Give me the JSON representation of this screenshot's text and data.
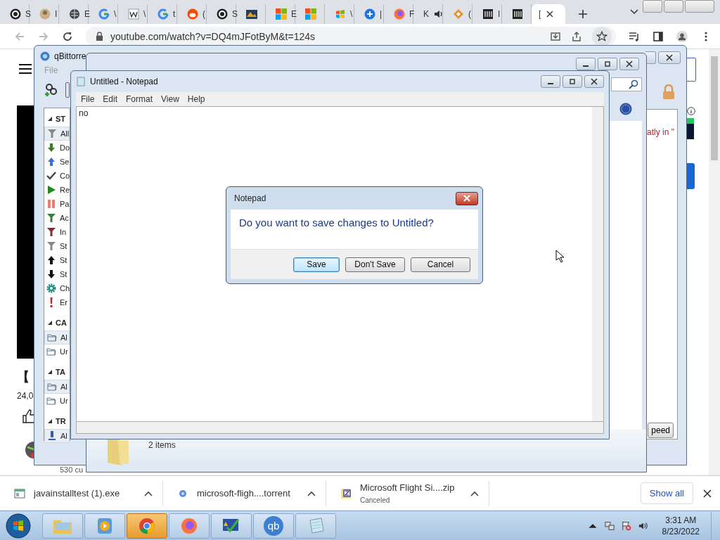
{
  "browser": {
    "tabs": [
      {
        "kind": "dial",
        "label": "S",
        "selected": false
      },
      {
        "kind": "avatar",
        "label": "I",
        "selected": false
      },
      {
        "kind": "globe",
        "label": "E",
        "selected": false
      },
      {
        "kind": "google",
        "label": "\\",
        "selected": false
      },
      {
        "kind": "wiki",
        "label": "\\",
        "selected": false
      },
      {
        "kind": "google",
        "label": "t",
        "selected": false
      },
      {
        "kind": "reddit",
        "label": "(",
        "selected": false
      },
      {
        "kind": "dial",
        "label": "S",
        "selected": false
      },
      {
        "kind": "hfs",
        "selected": false
      },
      {
        "kind": "ms",
        "label": "E",
        "selected": false
      },
      {
        "kind": "ms",
        "selected": false
      },
      {
        "kind": "win",
        "label": "\\",
        "selected": false
      },
      {
        "kind": "edge",
        "label": "|",
        "selected": false
      },
      {
        "kind": "firefox",
        "label": "F",
        "selected": false
      },
      {
        "kind": "speaker",
        "label": "K",
        "selected": false
      },
      {
        "kind": "diamond",
        "label": "(",
        "selected": false
      },
      {
        "kind": "museum",
        "label": "I",
        "selected": false
      },
      {
        "kind": "museum",
        "selected": false
      },
      {
        "kind": "none",
        "label": "[",
        "selected": true
      }
    ],
    "url": "youtube.com/watch?v=DQ4mJFotByM&t=124s"
  },
  "page": {
    "title": "【",
    "views": "24,0",
    "comment": "530 cu"
  },
  "qbittorrent": {
    "title": "qBittorre",
    "menu": [
      "File"
    ],
    "sections": [
      {
        "header": "ST",
        "items": [
          {
            "kind": "filter-grey",
            "label": "All",
            "selected": true
          },
          {
            "kind": "down-green",
            "label": "Do",
            "selected": false
          },
          {
            "kind": "up-blue",
            "label": "Se",
            "selected": false
          },
          {
            "kind": "check",
            "label": "Co",
            "selected": false
          },
          {
            "kind": "play",
            "label": "Re",
            "selected": false
          },
          {
            "kind": "pause",
            "label": "Pa",
            "selected": false
          },
          {
            "kind": "filter-green",
            "label": "Ac",
            "selected": false
          },
          {
            "kind": "filter-red",
            "label": "In",
            "selected": false
          },
          {
            "kind": "filter-grey",
            "label": "St",
            "selected": false
          },
          {
            "kind": "up-black",
            "label": "St",
            "selected": false
          },
          {
            "kind": "down-black",
            "label": "St",
            "selected": false
          },
          {
            "kind": "gear",
            "label": "Ch",
            "selected": false
          },
          {
            "kind": "error",
            "label": "Er",
            "selected": false
          }
        ]
      },
      {
        "header": "CA",
        "items": [
          {
            "kind": "folder",
            "label": "Al",
            "selected": true
          },
          {
            "kind": "folder",
            "label": "Ur",
            "selected": false
          }
        ]
      },
      {
        "header": "TA",
        "items": [
          {
            "kind": "folder",
            "label": "Al",
            "selected": true
          },
          {
            "kind": "folder",
            "label": "Ur",
            "selected": false
          }
        ]
      },
      {
        "header": "TR",
        "items": [
          {
            "kind": "tracker",
            "label": "Al",
            "selected": true
          }
        ]
      }
    ],
    "column_text": "atly in \"",
    "button": "peed"
  },
  "explorer": {
    "status": "2 items"
  },
  "notepad": {
    "title": "Untitled - Notepad",
    "menu": [
      "File",
      "Edit",
      "Format",
      "View",
      "Help"
    ],
    "text": "no"
  },
  "dialog": {
    "title": "Notepad",
    "message": "Do you want to save changes to Untitled?",
    "buttons": [
      {
        "label": "Save",
        "default": true
      },
      {
        "label": "Don't Save",
        "default": false
      },
      {
        "label": "Cancel",
        "default": false
      }
    ]
  },
  "downloads": {
    "items": [
      {
        "kind": "exe",
        "name": "javainstalltest (1).exe"
      },
      {
        "kind": "torrent",
        "name": "microsoft-fligh....torrent"
      },
      {
        "kind": "zip",
        "name": "Microsoft Flight Si....zip",
        "status": "Canceled"
      }
    ],
    "show_all": "Show all"
  },
  "taskbar": {
    "apps": [
      {
        "kind": "explorer",
        "active": false
      },
      {
        "kind": "media",
        "active": false
      },
      {
        "kind": "chrome",
        "active": true
      },
      {
        "kind": "firefox",
        "active": false
      },
      {
        "kind": "tool",
        "active": false
      },
      {
        "kind": "qb",
        "label": "qb",
        "active": false
      },
      {
        "kind": "notepad",
        "active": false
      }
    ],
    "time": "3:31 AM",
    "date": "8/23/2022"
  }
}
